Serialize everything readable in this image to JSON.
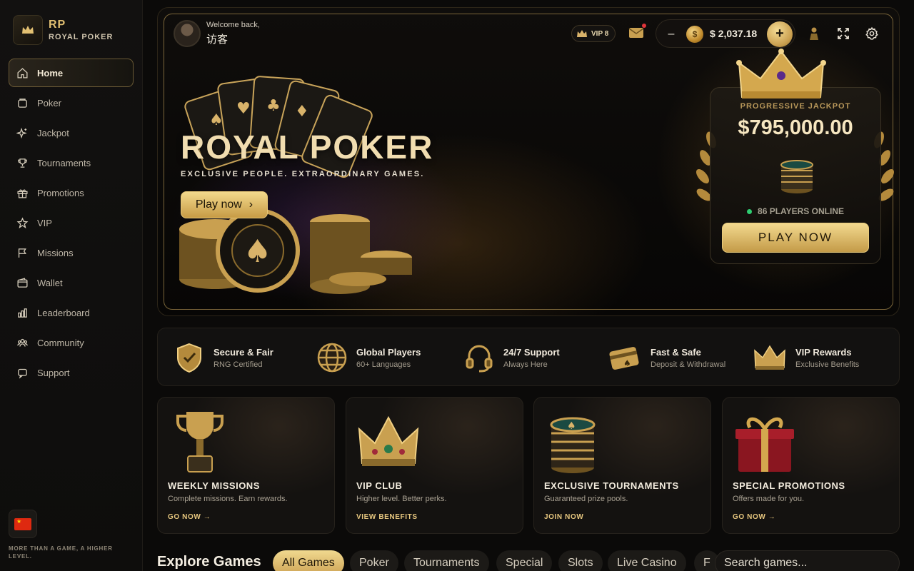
{
  "brand": {
    "initials": "RP",
    "name": "ROYAL POKER",
    "tagline": "MORE THAN A GAME, A HIGHER LEVEL."
  },
  "sidebar": {
    "items": [
      {
        "label": "Home",
        "icon": "home-icon",
        "active": true
      },
      {
        "label": "Poker",
        "icon": "poker-chip-icon"
      },
      {
        "label": "Jackpot",
        "icon": "sparkle-icon"
      },
      {
        "label": "Tournaments",
        "icon": "trophy-icon"
      },
      {
        "label": "Promotions",
        "icon": "gift-icon"
      },
      {
        "label": "VIP",
        "icon": "star-icon"
      },
      {
        "label": "Missions",
        "icon": "flag-icon"
      },
      {
        "label": "Wallet",
        "icon": "wallet-icon"
      },
      {
        "label": "Leaderboard",
        "icon": "bar-chart-icon"
      },
      {
        "label": "Community",
        "icon": "users-icon"
      },
      {
        "label": "Support",
        "icon": "chat-icon"
      }
    ],
    "language_icon": "china-flag-icon"
  },
  "header": {
    "welcome": "Welcome back,",
    "username": "访客",
    "vip_level": "VIP 8",
    "balance": "$ 2,037.18",
    "minus_label": "–",
    "plus_label": "+",
    "coin_symbol": "$"
  },
  "hero": {
    "title": "ROYAL POKER",
    "subtitle": "EXCLUSIVE PEOPLE. EXTRAORDINARY GAMES.",
    "cta": "Play now",
    "cta_arrow": "›"
  },
  "jackpot": {
    "label": "PROGRESSIVE JACKPOT",
    "amount": "$795,000.00",
    "online": "86 PLAYERS ONLINE",
    "cta": "PLAY NOW"
  },
  "features": [
    {
      "title": "Secure & Fair",
      "sub": "RNG Certified",
      "icon": "shield-icon"
    },
    {
      "title": "Global Players",
      "sub": "60+ Languages",
      "icon": "globe-icon"
    },
    {
      "title": "24/7 Support",
      "sub": "Always Here",
      "icon": "headset-icon"
    },
    {
      "title": "Fast & Safe",
      "sub": "Deposit & Withdrawal",
      "icon": "card-icon"
    },
    {
      "title": "VIP Rewards",
      "sub": "Exclusive Benefits",
      "icon": "crown-icon"
    }
  ],
  "promos": [
    {
      "title": "WEEKLY MISSIONS",
      "sub": "Complete missions. Earn rewards.",
      "link": "GO NOW →",
      "icon": "trophy-icon"
    },
    {
      "title": "VIP CLUB",
      "sub": "Higher level. Better perks.",
      "link": "VIEW BENEFITS",
      "icon": "crown-icon"
    },
    {
      "title": "EXCLUSIVE TOURNAMENTS",
      "sub": "Guaranteed prize pools.",
      "link": "JOIN NOW",
      "icon": "chip-stack-icon"
    },
    {
      "title": "SPECIAL PROMOTIONS",
      "sub": "Offers made for you.",
      "link": "GO NOW →",
      "icon": "gift-box-icon"
    }
  ],
  "explore": {
    "title": "Explore Games",
    "filters": [
      "All Games",
      "Poker",
      "Tournaments",
      "Special",
      "Slots",
      "Live Casino",
      "F"
    ],
    "search_placeholder": "Search games..."
  },
  "colors": {
    "accent": "#e2c072",
    "background": "#0b0a09",
    "online": "#2ecc71",
    "notification": "#e0343a"
  }
}
